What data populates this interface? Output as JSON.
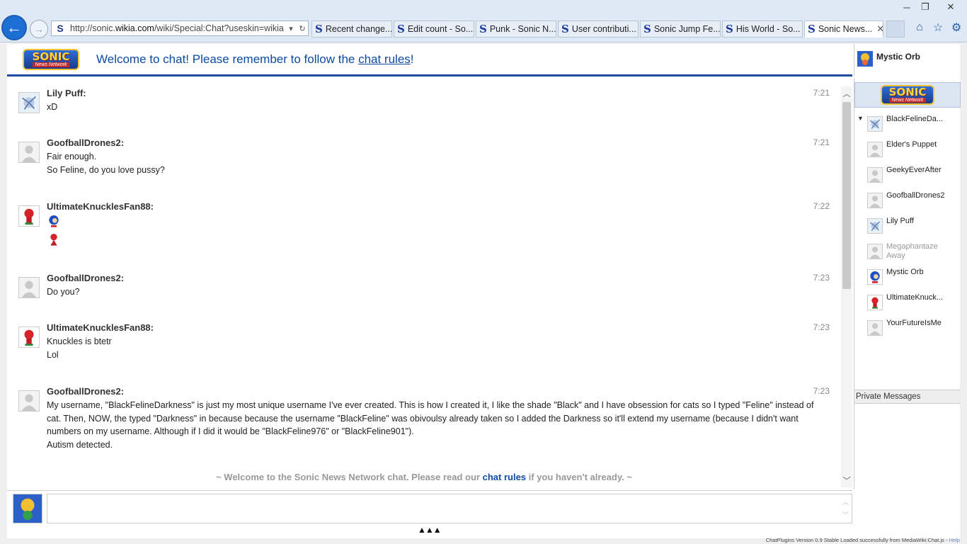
{
  "browser": {
    "url_prefix": "http://sonic.",
    "url_domain": "wikia.com",
    "url_path": "/wiki/Special:Chat?useskin=wikia",
    "tabs": [
      {
        "label": "Recent change...",
        "active": false
      },
      {
        "label": "Edit count - So...",
        "active": false
      },
      {
        "label": "Punk - Sonic N...",
        "active": false
      },
      {
        "label": "User contributi...",
        "active": false
      },
      {
        "label": "Sonic Jump Fe...",
        "active": false
      },
      {
        "label": "His World - So...",
        "active": false
      },
      {
        "label": "Sonic News...",
        "active": true
      }
    ],
    "tab_icon": "S",
    "colors": {
      "accent": "#1e6fd3",
      "chrome": "#dfe9f5"
    }
  },
  "header": {
    "logo_line1": "SONIC",
    "logo_line2": "News Network",
    "welcome_prefix": "Welcome to chat! Please remember to follow the ",
    "welcome_link": "chat rules",
    "welcome_suffix": "!"
  },
  "current_user": {
    "name": "Mystic Orb"
  },
  "messages": [
    {
      "user": "Lily Puff:",
      "time": "7:21",
      "lines": [
        "xD"
      ],
      "avatar": "lily-puff"
    },
    {
      "user": "GoofballDrones2:",
      "time": "7:21",
      "lines": [
        "Fair enough.",
        "So Feline, do you love pussy?"
      ],
      "avatar": "default"
    },
    {
      "user": "UltimateKnucklesFan88:",
      "time": "7:22",
      "lines": [],
      "emojis": [
        "sonic-emoticon",
        "knuckles-emoticon"
      ],
      "avatar": "knuckles"
    },
    {
      "user": "GoofballDrones2:",
      "time": "7:23",
      "lines": [
        "Do you?"
      ],
      "avatar": "default"
    },
    {
      "user": "UltimateKnucklesFan88:",
      "time": "7:23",
      "lines": [
        "Knuckles is btetr",
        "Lol"
      ],
      "avatar": "knuckles"
    },
    {
      "user": "GoofballDrones2:",
      "time": "7:23",
      "lines": [
        "My username, \"BlackFelineDarkness\" is just my most unique username I've ever created. This is how I created it, I like the shade \"Black\" and I have obsession for cats so I typed \"Feline\" instead of cat. Then, NOW, the typed \"Darkness\" in because because the username \"BlackFeline\" was obivoulsy already taken so I added the Darkness so it'll extend my username (because I didn't want numbers on my username. Although if I did it would be \"BlackFeline976\" or \"BlackFeline901\").",
        "Autism detected."
      ],
      "avatar": "default"
    }
  ],
  "system_message": {
    "prefix": "~ Welcome to the Sonic News Network chat. Please read our ",
    "link": "chat rules",
    "suffix": " if you haven't already. ~"
  },
  "users": [
    {
      "name": "BlackFelineDa...",
      "away": false
    },
    {
      "name": "Elder's Puppet",
      "away": false
    },
    {
      "name": "GeekyEverAfter",
      "away": false
    },
    {
      "name": "GoofballDrones2",
      "away": false
    },
    {
      "name": "Lily Puff",
      "away": false
    },
    {
      "name": "Megaphantaze Away",
      "away": true
    },
    {
      "name": "Mystic Orb",
      "away": false
    },
    {
      "name": "UltimateKnuck...",
      "away": false
    },
    {
      "name": "YourFutureIsMe",
      "away": false
    }
  ],
  "private_messages_label": "Private Messages",
  "expander": "▲▲▲",
  "status_bar": {
    "text": "ChatPlugins Version 0.9 Stable Loaded successfully from MediaWiki:Chat.js - ",
    "link": "Help"
  }
}
